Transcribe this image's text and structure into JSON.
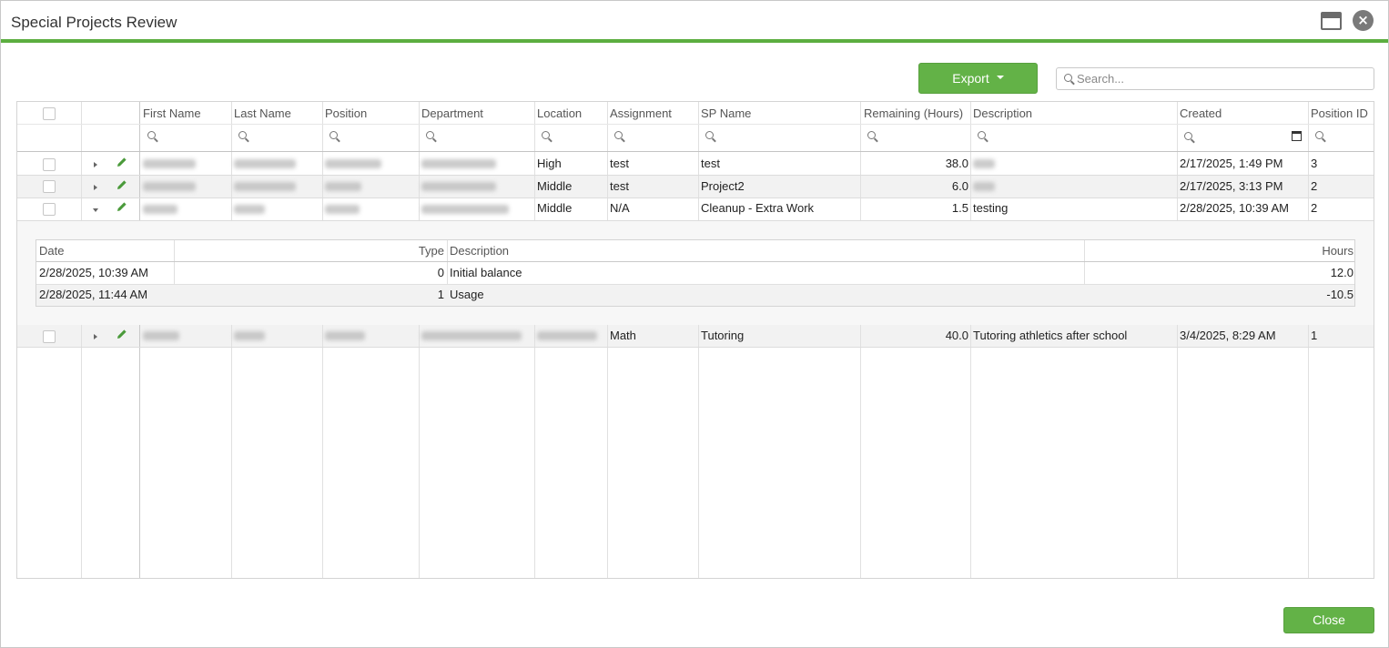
{
  "window": {
    "title": "Special Projects Review"
  },
  "toolbar": {
    "export_label": "Export",
    "search_placeholder": "Search..."
  },
  "grid": {
    "columns": [
      "First Name",
      "Last Name",
      "Position",
      "Department",
      "Location",
      "Assignment",
      "SP Name",
      "Remaining (Hours)",
      "Description",
      "Created",
      "Position ID"
    ],
    "rows": [
      {
        "location": "High",
        "assignment": "test",
        "sp_name": "test",
        "remaining": "38.0",
        "description": "",
        "created": "2/17/2025, 1:49 PM",
        "position_id": "3"
      },
      {
        "location": "Middle",
        "assignment": "test",
        "sp_name": "Project2",
        "remaining": "6.0",
        "description": "",
        "created": "2/17/2025, 3:13 PM",
        "position_id": "2"
      },
      {
        "location": "Middle",
        "assignment": "N/A",
        "sp_name": "Cleanup - Extra Work",
        "remaining": "1.5",
        "description": "testing",
        "created": "2/28/2025, 10:39 AM",
        "position_id": "2"
      },
      {
        "location": "",
        "assignment": "Math",
        "sp_name": "Tutoring",
        "remaining": "40.0",
        "description": "Tutoring athletics after school",
        "created": "3/4/2025, 8:29 AM",
        "position_id": "1"
      }
    ],
    "detail": {
      "columns": [
        "Date",
        "Type",
        "Description",
        "Hours"
      ],
      "rows": [
        {
          "date": "2/28/2025, 10:39 AM",
          "type": "0",
          "description": "Initial balance",
          "hours": "12.0"
        },
        {
          "date": "2/28/2025, 11:44 AM",
          "type": "1",
          "description": "Usage",
          "hours": "-10.5"
        }
      ]
    }
  },
  "footer": {
    "close_label": "Close"
  },
  "colors": {
    "accent": "#63b247",
    "title_rule": "#5cae40"
  }
}
